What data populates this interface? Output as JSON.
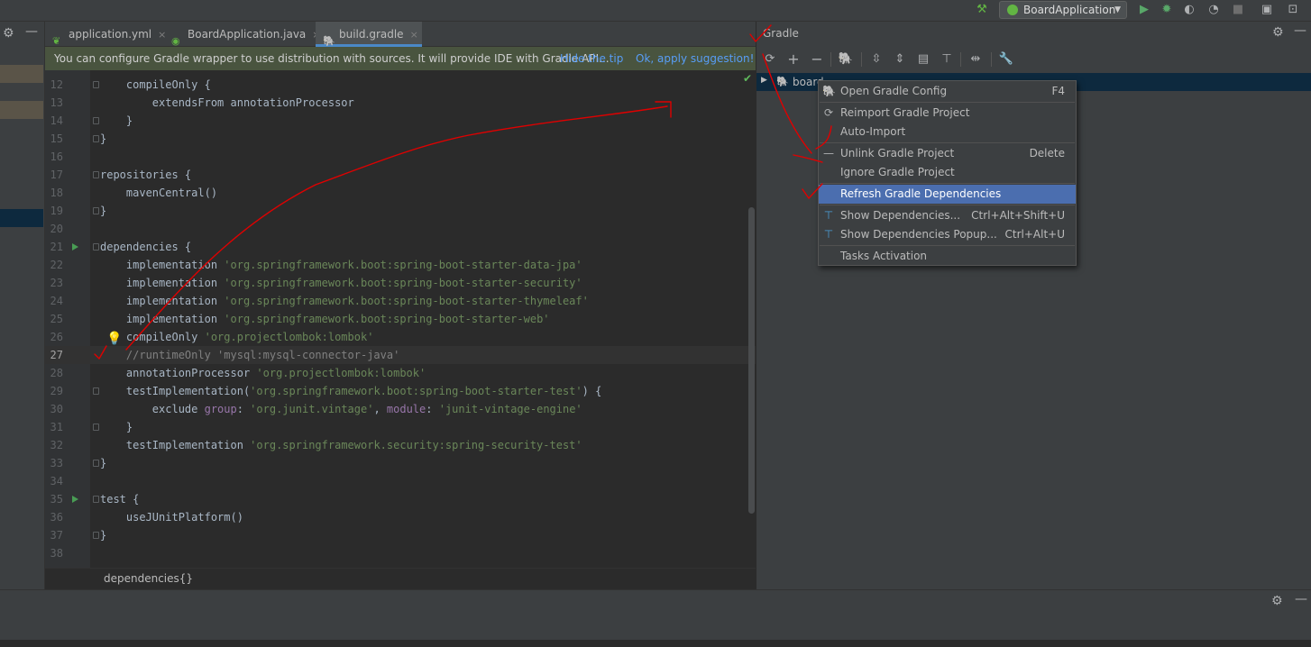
{
  "toolbar": {
    "run_config": "BoardApplication"
  },
  "tabs": [
    {
      "label": "application.yml",
      "close": "×"
    },
    {
      "label": "BoardApplication.java",
      "close": "×"
    },
    {
      "label": "build.gradle",
      "close": "×",
      "active": true
    }
  ],
  "notification": {
    "text": "You can configure Gradle wrapper to use distribution with sources. It will provide IDE with Gradle API...",
    "hide_tip": "Hide the tip",
    "apply": "Ok, apply suggestion!"
  },
  "editor": {
    "lines": [
      {
        "n": "12",
        "code": "    compileOnly {"
      },
      {
        "n": "13",
        "code": "        extendsFrom annotationProcessor"
      },
      {
        "n": "14",
        "code": "    }"
      },
      {
        "n": "15",
        "code": "}"
      },
      {
        "n": "16",
        "code": ""
      },
      {
        "n": "17",
        "code": "repositories {"
      },
      {
        "n": "18",
        "code": "    mavenCentral()"
      },
      {
        "n": "19",
        "code": "}"
      },
      {
        "n": "20",
        "code": ""
      },
      {
        "n": "21",
        "code": "dependencies {"
      },
      {
        "n": "22",
        "kw": "    implementation ",
        "str": "'org.springframework.boot:spring-boot-starter-data-jpa'"
      },
      {
        "n": "23",
        "kw": "    implementation ",
        "str": "'org.springframework.boot:spring-boot-starter-security'"
      },
      {
        "n": "24",
        "kw": "    implementation ",
        "str": "'org.springframework.boot:spring-boot-starter-thymeleaf'"
      },
      {
        "n": "25",
        "kw": "    implementation ",
        "str": "'org.springframework.boot:spring-boot-starter-web'"
      },
      {
        "n": "26",
        "kw": "    compileOnly ",
        "str": "'org.projectlombok:lombok'"
      },
      {
        "n": "27",
        "cmt": "    //runtimeOnly 'mysql:mysql-connector-java'"
      },
      {
        "n": "28",
        "kw": "    annotationProcessor ",
        "str": "'org.projectlombok:lombok'"
      },
      {
        "n": "29",
        "kw": "    testImplementation(",
        "str": "'org.springframework.boot:spring-boot-starter-test'",
        "tail": ") {"
      },
      {
        "n": "30",
        "kw": "        exclude ",
        "named1": "group",
        "mid1": ": ",
        "str1": "'org.junit.vintage'",
        "mid2": ", ",
        "named2": "module",
        "mid3": ": ",
        "str2": "'junit-vintage-engine'"
      },
      {
        "n": "31",
        "code": "    }"
      },
      {
        "n": "32",
        "kw": "    testImplementation ",
        "str": "'org.springframework.security:spring-security-test'"
      },
      {
        "n": "33",
        "code": "}"
      },
      {
        "n": "34",
        "code": ""
      },
      {
        "n": "35",
        "code": "test {"
      },
      {
        "n": "36",
        "code": "    useJUnitPlatform()"
      },
      {
        "n": "37",
        "code": "}"
      },
      {
        "n": "38",
        "code": ""
      }
    ],
    "breadcrumb": "dependencies{}"
  },
  "gradle": {
    "title": "Gradle",
    "tree_root": "board"
  },
  "context_menu": {
    "items": [
      {
        "label": "Open Gradle Config",
        "shortcut": "F4",
        "icon": "gradle-elephant-icon"
      },
      {
        "label": "Reimport Gradle Project",
        "shortcut": "",
        "icon": "refresh-icon"
      },
      {
        "label": "Auto-Import",
        "shortcut": "",
        "icon": ""
      },
      {
        "label": "Unlink Gradle Project",
        "shortcut": "Delete",
        "icon": "minus-icon"
      },
      {
        "label": "Ignore Gradle Project",
        "shortcut": "",
        "icon": ""
      },
      {
        "label": "Refresh Gradle Dependencies",
        "shortcut": "",
        "icon": "",
        "selected": true
      },
      {
        "label": "Show Dependencies...",
        "shortcut": "Ctrl+Alt+Shift+U",
        "icon": "diagram-icon"
      },
      {
        "label": "Show Dependencies Popup...",
        "shortcut": "Ctrl+Alt+U",
        "icon": "diagram-icon"
      },
      {
        "label": "Tasks Activation",
        "shortcut": "",
        "icon": ""
      }
    ]
  },
  "colors": {
    "selection": "#4b6eaf",
    "annotation": "#e00000",
    "string": "#6a8759",
    "comment": "#808080"
  }
}
